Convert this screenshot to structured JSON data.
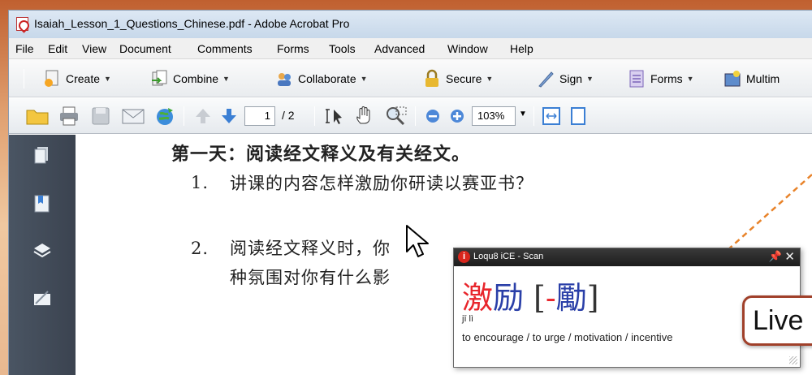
{
  "window": {
    "title": "Isaiah_Lesson_1_Questions_Chinese.pdf - Adobe Acrobat Pro"
  },
  "menu": [
    "File",
    "Edit",
    "View",
    "Document",
    "Comments",
    "Forms",
    "Tools",
    "Advanced",
    "Window",
    "Help"
  ],
  "tasks": {
    "create": "Create",
    "combine": "Combine",
    "collaborate": "Collaborate",
    "secure": "Secure",
    "sign": "Sign",
    "forms": "Forms",
    "multimedia": "Multim"
  },
  "nav": {
    "page_current": "1",
    "page_total": "/ 2",
    "zoom": "103%"
  },
  "document": {
    "heading": "第一天：阅读经文释义及有关经文。",
    "q1_num": "1.",
    "q1_text": "讲课的内容怎样激励你研读以赛亚书？",
    "q2_num": "2.",
    "q2_line1": "阅读经文释义时，你",
    "q2_line2": "种氛围对你有什么影"
  },
  "popup": {
    "badge": "i",
    "title": "Loqu8 iCE - Scan",
    "word_simplified": "激励",
    "word_traditional": "[-勵]",
    "pinyin": "jī lì",
    "definition": "to encourage / to urge / motivation / incentive"
  },
  "callout": {
    "label": "Live"
  },
  "colors": {
    "tone1": "#e8262c",
    "tone4": "#2a3fa8",
    "callout_border": "#a0402a",
    "callout_line": "#e8832a"
  }
}
